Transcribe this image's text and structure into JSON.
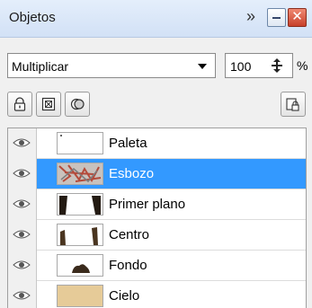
{
  "panel": {
    "title": "Objetos",
    "overflow_glyph": "»",
    "close_glyph": "✕"
  },
  "blend": {
    "mode": "Multiplicar",
    "opacity": "100",
    "unit": "%"
  },
  "tools": [
    "lock-icon",
    "mask-icon",
    "layer-merge-icon",
    "lock-layer-icon"
  ],
  "layers": [
    {
      "name": "Paleta",
      "selected": false,
      "thumb": "palette"
    },
    {
      "name": "Esbozo",
      "selected": true,
      "thumb": "sketch"
    },
    {
      "name": "Primer plano",
      "selected": false,
      "thumb": "foreground"
    },
    {
      "name": "Centro",
      "selected": false,
      "thumb": "middle"
    },
    {
      "name": "Fondo",
      "selected": false,
      "thumb": "background"
    },
    {
      "name": "Cielo",
      "selected": false,
      "thumb": "sky"
    }
  ],
  "colors": {
    "selection": "#3399ff",
    "sky_thumb": "#e6cb98",
    "sketch_thumb": "#b44a3a"
  }
}
